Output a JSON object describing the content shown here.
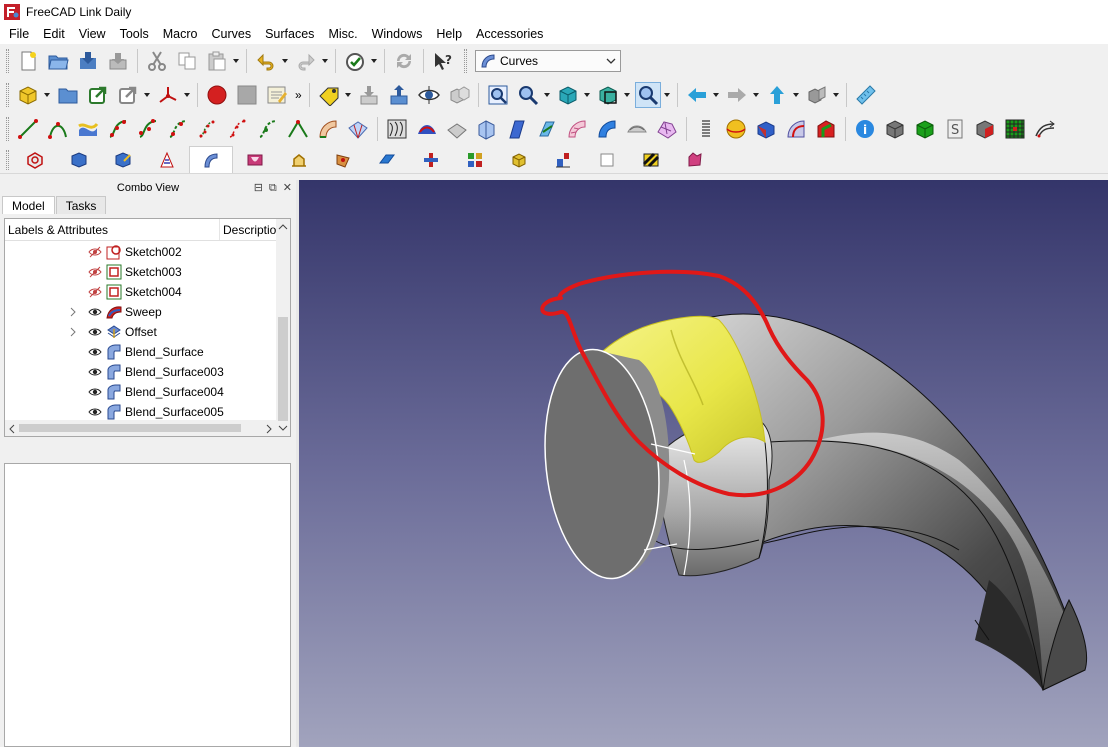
{
  "window": {
    "title": "FreeCAD Link Daily"
  },
  "menu": [
    "File",
    "Edit",
    "View",
    "Tools",
    "Macro",
    "Curves",
    "Surfaces",
    "Misc.",
    "Windows",
    "Help",
    "Accessories"
  ],
  "workbench_selector": {
    "value": "Curves",
    "icon": "curves-workbench-icon"
  },
  "combo_view": {
    "title": "Combo View",
    "tabs": [
      "Model",
      "Tasks"
    ],
    "columns": [
      "Labels & Attributes",
      "Description"
    ],
    "items": [
      {
        "label": "Sketch002",
        "icon": "sketch-icon",
        "visible": false,
        "expandable": false
      },
      {
        "label": "Sketch003",
        "icon": "sketch-icon",
        "visible": false,
        "expandable": false
      },
      {
        "label": "Sketch004",
        "icon": "sketch-icon",
        "visible": false,
        "expandable": false
      },
      {
        "label": "Sweep",
        "icon": "sweep-icon",
        "visible": true,
        "expandable": true
      },
      {
        "label": "Offset",
        "icon": "offset-icon",
        "visible": true,
        "expandable": true
      },
      {
        "label": "Blend_Surface",
        "icon": "blend-surface-icon",
        "visible": true,
        "expandable": false
      },
      {
        "label": "Blend_Surface003",
        "icon": "blend-surface-icon",
        "visible": true,
        "expandable": false
      },
      {
        "label": "Blend_Surface004",
        "icon": "blend-surface-icon",
        "visible": true,
        "expandable": false
      },
      {
        "label": "Blend_Surface005",
        "icon": "blend-surface-icon",
        "visible": true,
        "expandable": false
      }
    ]
  },
  "colors": {
    "viewport_top": "#34356a",
    "viewport_bottom": "#a1a3bd",
    "selection_highlight": "#f2f05a",
    "annotation_stroke": "#e01818"
  }
}
